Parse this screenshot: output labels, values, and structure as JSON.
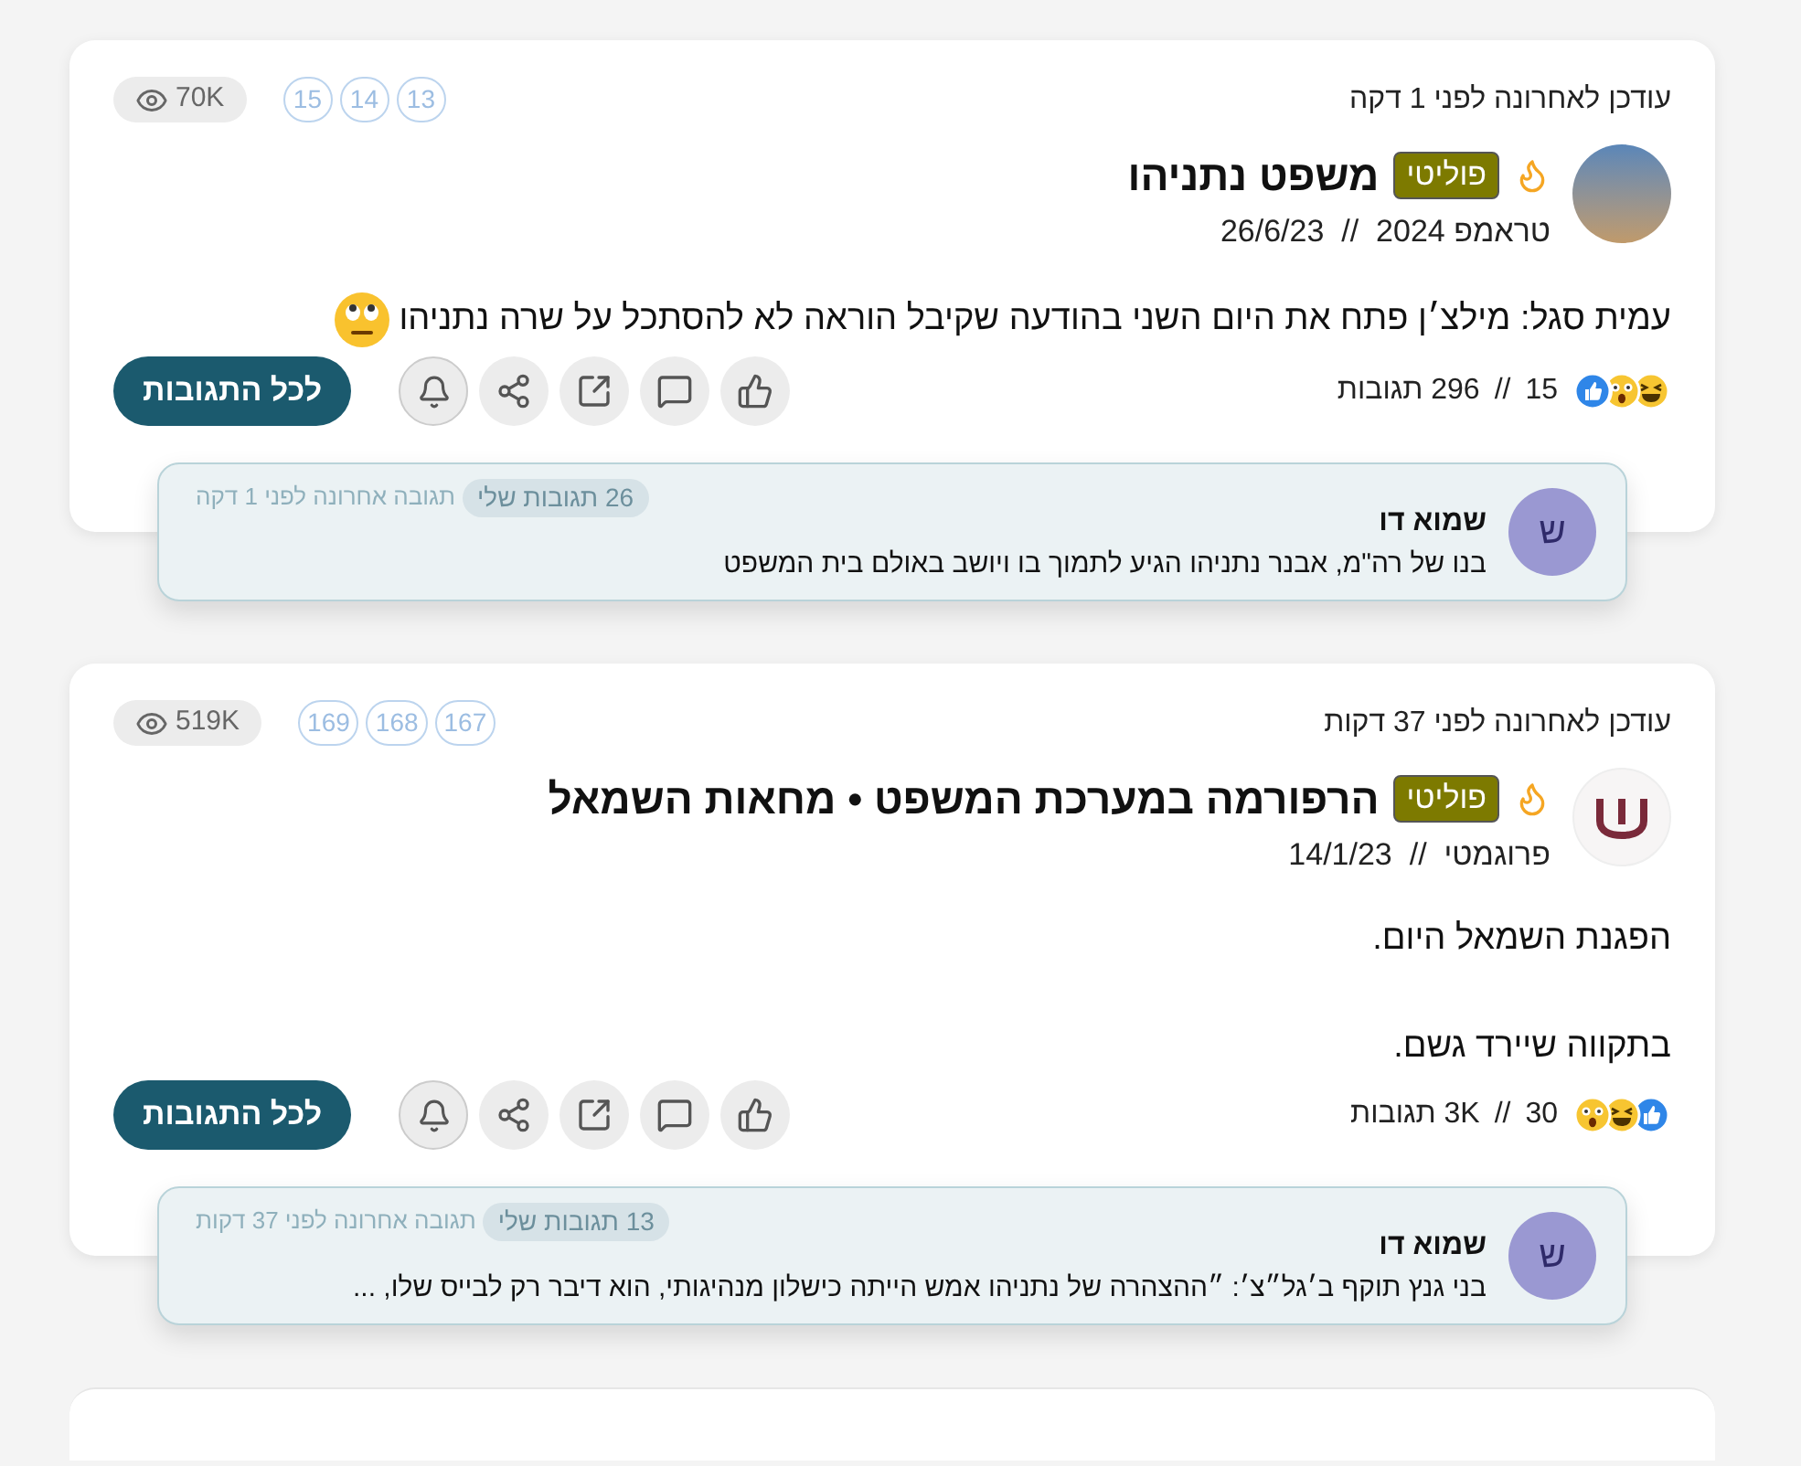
{
  "posts": [
    {
      "updated": "עודכן לאחרונה לפני 1 דקה",
      "pages": [
        "13",
        "14",
        "15"
      ],
      "views": "70K",
      "avatar": {
        "kind": "photo"
      },
      "tag": "פוליטי",
      "title": "משפט נתניהו",
      "subtitle": "טראמפ 2024  //  26/6/23",
      "paragraphs": [
        "עמית סגל: מילצ׳ן פתח את היום השני בהודעה שקיבל הוראה לא להסתכל על שרה נתניהו"
      ],
      "trailing_emoji": true,
      "reactions": [
        {
          "kind": "laugh"
        },
        {
          "kind": "shocked"
        },
        {
          "kind": "like"
        }
      ],
      "reaction_count": "15",
      "separator": "//",
      "comments_count": "296 תגובות",
      "all_comments": "לכל התגובות",
      "reply": {
        "avatar_letter": "ש",
        "name": "שמוא דו",
        "text": "בנו של רה\"מ, אבנר נתניהו הגיע לתמוך בו ויושב באולם בית המשפט",
        "my_count": "26 תגובות שלי",
        "last": "תגובה אחרונה לפני 1 דקה"
      }
    },
    {
      "updated": "עודכן לאחרונה לפני 37 דקות",
      "pages": [
        "167",
        "168",
        "169"
      ],
      "views": "519K",
      "avatar": {
        "kind": "logo"
      },
      "tag": "פוליטי",
      "title": "הרפורמה במערכת המשפט • מחאות השמאל",
      "subtitle": "פרוגמטי  //  14/1/23",
      "paragraphs": [
        "הפגנת השמאל היום.",
        "בתקווה שיירד גשם."
      ],
      "trailing_emoji": false,
      "reactions": [
        {
          "kind": "like"
        },
        {
          "kind": "laugh"
        },
        {
          "kind": "shocked"
        }
      ],
      "reaction_count": "30",
      "separator": "//",
      "comments_count": "3K תגובות",
      "all_comments": "לכל התגובות",
      "reply": {
        "avatar_letter": "ש",
        "name": "שמוא דו",
        "text": "בני גנץ תוקף ב׳גל״צ׳: ״ההצהרה של נתניהו אמש הייתה כישלון מנהיגותי, הוא דיבר רק לבייס שלו, ...",
        "my_count": "13 תגובות שלי",
        "last": "תגובה אחרונה לפני 37 דקות"
      }
    }
  ]
}
